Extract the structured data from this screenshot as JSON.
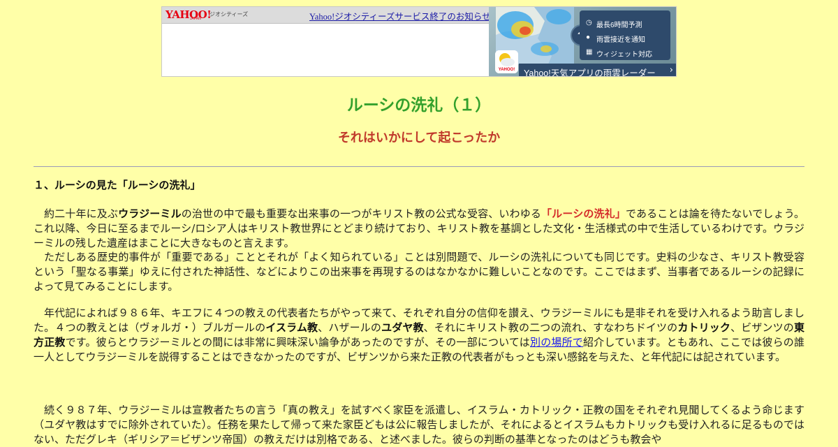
{
  "banner": {
    "logo": "YAHOO!",
    "logo_sub": "JAPAN",
    "service": "ジオシティーズ",
    "notice_link": "Yahoo!ジオシティーズサービス終了のお知らせ",
    "ad": {
      "features": [
        "最長6時間予測",
        "雨雲接近を通知",
        "ウィジェット対応"
      ],
      "footer": "Yahoo!天気アプリの雨雲レーダー",
      "app_label": "YAHOO!"
    }
  },
  "page": {
    "title": "ルーシの洗礼（１）",
    "subtitle": "それはいかにして起こったか",
    "section_heading": "１、ルーシの見た「ルーシの洗礼」"
  },
  "paragraphs": {
    "p1": {
      "a": "約二十年に及ぶ",
      "b_vladimir": "ウラジーミル",
      "c": "の治世の中で最も重要な出来事の一つがキリスト教の公式な受容、いわゆる",
      "d_baptism": "「ルーシの洗礼」",
      "e": "であることは論を待たないでしょう。これ以降、今日に至るまでルーシ/ロシア人はキリスト教世界にとどまり続けており、キリスト教を基調とした文化・生活様式の中で生活しているわけです。ウラジーミルの残した遺産はまことに大きなものと言えます。"
    },
    "p2": "ただしある歴史的事件が「重要である」こととそれが「よく知られている」ことは別問題で、ルーシの洗礼についても同じです。史料の少なさ、キリスト教受容という「聖なる事業」ゆえに付された神話性、などによりこの出来事を再現するのはなかなかに難しいことなのです。ここではまず、当事者であるルーシの記録によって見てみることにします。",
    "p3": {
      "a": "年代記によれば９８６年、キエフに４つの教えの代表者たちがやって来て、それぞれ自分の信仰を讃え、ウラジーミルにも是非それを受け入れるよう助言しました。４つの教えとは（ヴォルガ・）ブルガールの",
      "b_islam": "イスラム教",
      "c": "、ハザールの",
      "d_judaism": "ユダヤ教",
      "e": "、それにキリスト教の二つの流れ、すなわちドイツの",
      "f_catholic": "カトリック",
      "g": "、ビザンツの",
      "h_orthodox": "東方正教",
      "i": "です。彼らとウラジーミルとの間には非常に興味深い論争があったのですが、その一部については",
      "link": "別の場所で",
      "j": "紹介しています。ともあれ、ここでは彼らの誰一人としてウラジーミルを説得することはできなかったのですが、ビザンツから来た正教の代表者がもっとも深い感銘を与えた、と年代記には記されています。"
    },
    "p4": "続く９８７年、ウラジーミルは宣教者たちの言う「真の教え」を試すべく家臣を派遣し、イスラム・カトリック・正教の国をそれぞれ見聞してくるよう命じます（ユダヤ教はすでに除外されていた）。任務を果たして帰って来た家臣どもは公に報告しましたが、それによるとイスラムもカトリックも受け入れるに足るものではない、ただグレキ（ギリシア＝ビザンツ帝国）の教えだけは別格である、と述べました。彼らの判断の基準となったのはどうも教会や"
  },
  "colors": {
    "background": "#ffffa8",
    "title": "#33a02c",
    "subtitle": "#c0392b",
    "emphasis_red": "#d42a2a",
    "link": "#1a1aee"
  },
  "icons": [
    "clock-icon",
    "location-pin-icon",
    "widget-grid-icon",
    "rain-cloud-icon",
    "chevron-right-icon",
    "weather-app-icon"
  ]
}
